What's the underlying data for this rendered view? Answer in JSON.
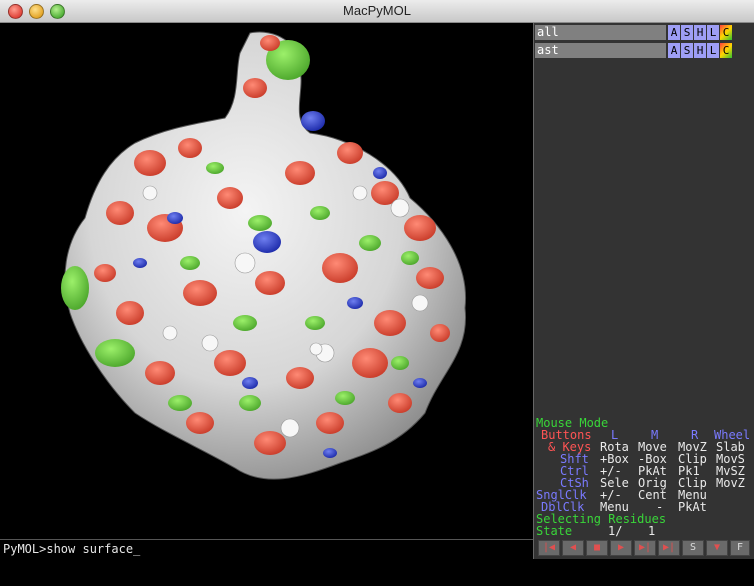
{
  "window": {
    "title": "MacPyMOL"
  },
  "objects": [
    {
      "name": "all",
      "buttons": [
        "A",
        "S",
        "H",
        "L",
        "C"
      ]
    },
    {
      "name": "ast",
      "buttons": [
        "A",
        "S",
        "H",
        "L",
        "C"
      ]
    }
  ],
  "mouse_mode": {
    "header": "Mouse Mode",
    "rows": [
      {
        "label": "Buttons",
        "c1": "L",
        "c2": "M",
        "c3": "R",
        "c4": "Wheel"
      },
      {
        "label": "& Keys",
        "c1": "Rota",
        "c2": "Move",
        "c3": "MovZ",
        "c4": "Slab"
      },
      {
        "label": "Shft",
        "c1": "+Box",
        "c2": "-Box",
        "c3": "Clip",
        "c4": "MovS"
      },
      {
        "label": "Ctrl",
        "c1": "+/-",
        "c2": "PkAt",
        "c3": "Pk1",
        "c4": "MvSZ"
      },
      {
        "label": "CtSh",
        "c1": "Sele",
        "c2": "Orig",
        "c3": "Clip",
        "c4": "MovZ"
      },
      {
        "label": "SnglClk",
        "c1": "+/-",
        "c2": "Cent",
        "c3": "Menu",
        "c4": ""
      },
      {
        "label": "DblClk",
        "c1": "Menu",
        "c2": "-",
        "c3": "PkAt",
        "c4": ""
      }
    ],
    "selecting": "Selecting Residues",
    "state_label": "State",
    "state_value": "1/",
    "state_total": "1"
  },
  "command_line": {
    "text": "PyMOL>show surface_"
  },
  "player_buttons": [
    "|◀",
    "◀",
    "■",
    "▶",
    "▶|",
    "▶|",
    "S",
    "▼",
    "F"
  ],
  "colors": {
    "carbon": "#e8e8e8",
    "oxygen": "#e8503c",
    "nitrogen": "#2030c0",
    "highlight": "#6ad13a"
  }
}
